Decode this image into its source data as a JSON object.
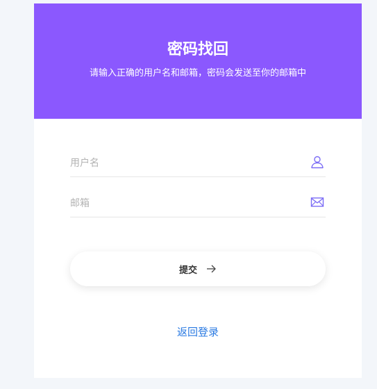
{
  "header": {
    "title": "密码找回",
    "subtitle": "请输入正确的用户名和邮箱，密码会发送至你的邮箱中"
  },
  "form": {
    "username_placeholder": "用户名",
    "username_value": "",
    "email_placeholder": "邮箱",
    "email_value": "",
    "submit_label": "提交"
  },
  "footer": {
    "back_label": "返回登录"
  },
  "icons": {
    "username": "user-icon",
    "email": "mail-icon",
    "submit": "arrow-right-icon"
  },
  "colors": {
    "accent": "#8b58fe",
    "link": "#2a7ae2",
    "icon": "#7b6cf6"
  }
}
